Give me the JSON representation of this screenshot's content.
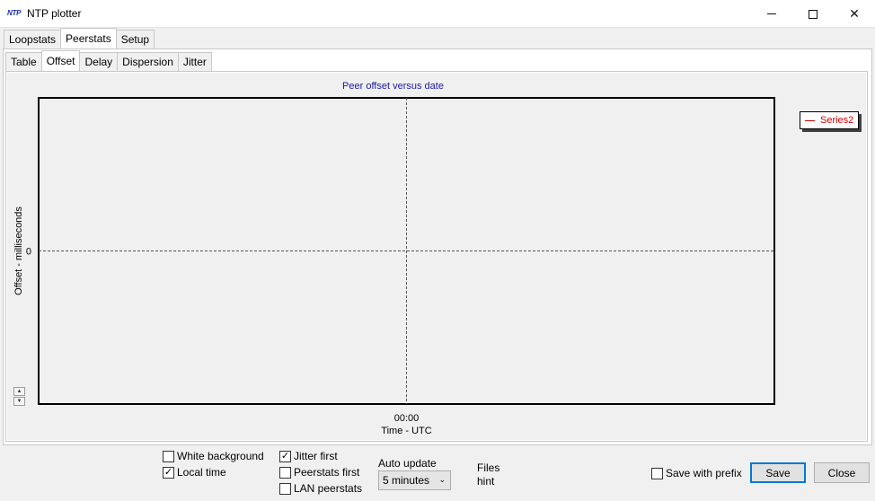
{
  "window": {
    "icon_text": "NTP",
    "title": "NTP plotter"
  },
  "main_tabs": [
    "Loopstats",
    "Peerstats",
    "Setup"
  ],
  "sub_tabs": [
    "Table",
    "Offset",
    "Delay",
    "Dispersion",
    "Jitter"
  ],
  "chart_data": {
    "type": "line",
    "title": "Peer offset versus date",
    "xlabel": "Time - UTC",
    "ylabel": "Offset - milliseconds",
    "x_ticks": [
      "00:00"
    ],
    "y_ticks": [
      "0"
    ],
    "series": [
      {
        "name": "Series2",
        "color": "#d00000",
        "values": []
      }
    ],
    "grid": "dashed crosshair at origin",
    "legend_position": "top-right",
    "title_color": "#1a1aa8"
  },
  "options": {
    "white_background": {
      "label": "White background",
      "checked": false
    },
    "local_time": {
      "label": "Local time",
      "checked": true
    },
    "jitter_first": {
      "label": "Jitter first",
      "checked": true
    },
    "peerstats_first": {
      "label": "Peerstats first",
      "checked": false
    },
    "lan_peerstats": {
      "label": "LAN peerstats",
      "checked": false
    },
    "save_with_prefix": {
      "label": "Save with prefix",
      "checked": false
    }
  },
  "auto_update": {
    "label": "Auto update",
    "selected": "5 minutes"
  },
  "files_hint": {
    "line1": "Files",
    "line2": "hint"
  },
  "buttons": {
    "save": "Save",
    "close": "Close"
  },
  "scroll": {
    "up": "▲",
    "down": "▼"
  },
  "checkmark": "✓"
}
